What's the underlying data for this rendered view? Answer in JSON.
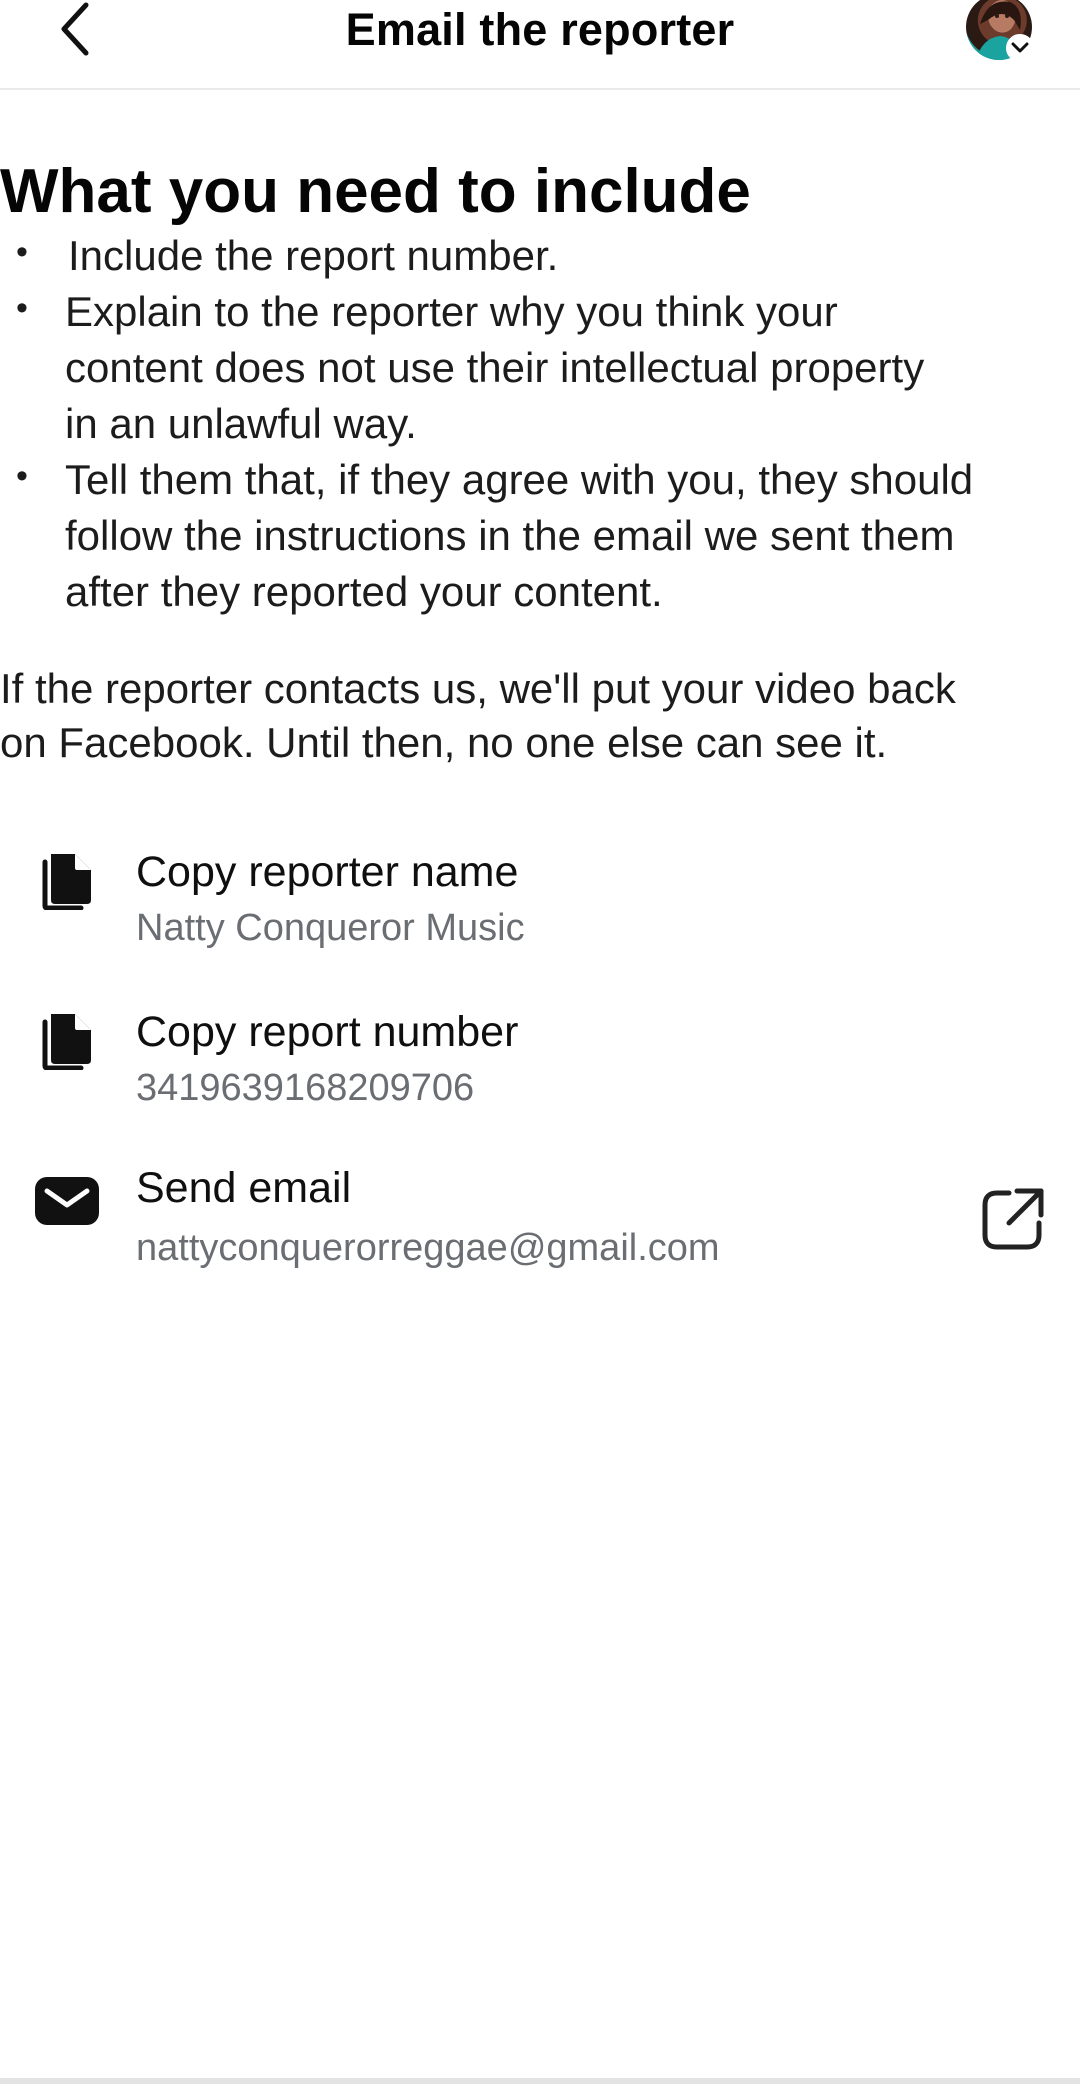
{
  "header": {
    "title": "Email the reporter",
    "back_icon": "chevron-left-icon",
    "account_icon": "avatar-with-chevron"
  },
  "main": {
    "heading": "What you need to include",
    "bullets": [
      "Include the report number.",
      "Explain to the reporter why you think your content does not use their intellectual property in an unlawful way.",
      "Tell them that, if they agree with you, they should follow the instructions in the email we sent them after they reported your content."
    ],
    "bullet_lines": [
      [
        "Include the report number."
      ],
      [
        "Explain to the reporter why you think your",
        "content does not use their intellectual property",
        "in an unlawful way."
      ],
      [
        "Tell them that, if they agree with you, they should",
        "follow the instructions in the email we sent them",
        "after they reported your content."
      ]
    ],
    "paragraph_lines": [
      "If the reporter contacts us, we'll put your video back",
      "on Facebook. Until then, no one else can see it."
    ]
  },
  "actions": [
    {
      "title": "Copy reporter name",
      "value": "Natty Conqueror Music",
      "icon": "copy-icon"
    },
    {
      "title": "Copy report number",
      "value": "3419639168209706",
      "icon": "copy-icon"
    },
    {
      "title": "Send email",
      "value": "nattyconquerorreggae@gmail.com",
      "icon": "envelope-icon",
      "trailing_icon": "open-external-icon"
    }
  ],
  "colors": {
    "text_primary": "#050505",
    "text_secondary": "#6a6e73",
    "divider": "#e9e9e9",
    "background": "#ffffff"
  }
}
